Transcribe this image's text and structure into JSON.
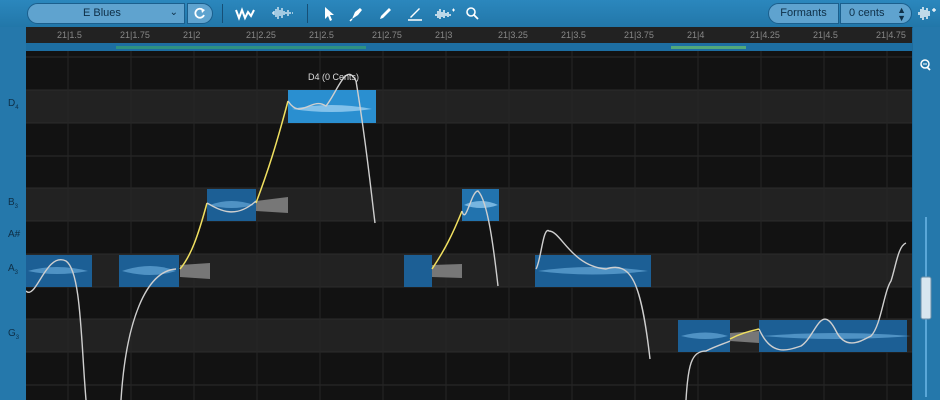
{
  "toolbar": {
    "scale_label": "E Blues",
    "formants_label": "Formants",
    "cents_value": "0 cents"
  },
  "ruler": {
    "ticks": [
      "21|1.5",
      "21|1.75",
      "21|2",
      "21|2.25",
      "21|2.5",
      "21|2.75",
      "21|3",
      "21|3.25",
      "21|3.5",
      "21|3.75",
      "21|4",
      "21|4.25",
      "21|4.5",
      "21|4.75"
    ]
  },
  "pitch_labels": {
    "d4": "D",
    "d4_oct": "4",
    "b3": "B",
    "b3_oct": "3",
    "asharp": "A#",
    "a3": "A",
    "a3_oct": "3",
    "g3": "G",
    "g3_oct": "3"
  },
  "tooltip": {
    "text": "D4 (0 Cents)"
  },
  "colors": {
    "note_blob": "#1c5f95",
    "note_selected": "#2a8fd0",
    "pitch_curve": "#cfcfcf",
    "transition": "#f0e060",
    "grid_bg": "#121212",
    "toolbar": "#2880b6"
  },
  "icons": {
    "snap": "refresh-icon",
    "pitch_tool": "pitch-wave-icon",
    "amplitude_tool": "waveform-icon",
    "pointer_tool": "pointer-icon",
    "pen_tool": "pen-icon",
    "pencil_tool": "pencil-icon",
    "line_tool": "line-tool-icon",
    "gain_tool": "gain-icon",
    "zoom_tool": "magnifier-icon"
  }
}
